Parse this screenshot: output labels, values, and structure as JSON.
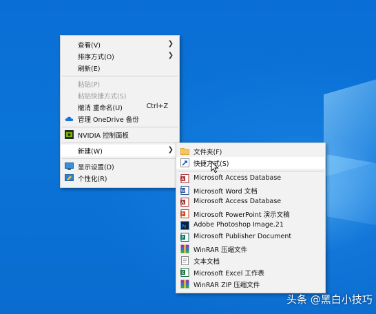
{
  "context_menu": {
    "items": [
      {
        "label": "查看(V)"
      },
      {
        "label": "排序方式(O)"
      },
      {
        "label": "刷新(E)"
      },
      {
        "label": "粘贴(P)"
      },
      {
        "label": "粘贴快捷方式(S)"
      },
      {
        "label": "撤消 重命名(U)",
        "shortcut": "Ctrl+Z"
      },
      {
        "label": "管理 OneDrive 备份"
      },
      {
        "label": "NVIDIA 控制面板"
      },
      {
        "label": "新建(W)"
      },
      {
        "label": "显示设置(D)"
      },
      {
        "label": "个性化(R)"
      }
    ]
  },
  "new_submenu": {
    "items": [
      {
        "label": "文件夹(F)"
      },
      {
        "label": "快捷方式(S)"
      },
      {
        "label": "Microsoft Access Database"
      },
      {
        "label": "Microsoft Word 文档"
      },
      {
        "label": "Microsoft Access Database"
      },
      {
        "label": "Microsoft PowerPoint 演示文稿"
      },
      {
        "label": "Adobe Photoshop Image.21"
      },
      {
        "label": "Microsoft Publisher Document"
      },
      {
        "label": "WinRAR 压缩文件"
      },
      {
        "label": "文本文档"
      },
      {
        "label": "Microsoft Excel 工作表"
      },
      {
        "label": "WinRAR ZIP 压缩文件"
      }
    ]
  },
  "watermark": {
    "text": "头条 @黑白小技巧"
  }
}
